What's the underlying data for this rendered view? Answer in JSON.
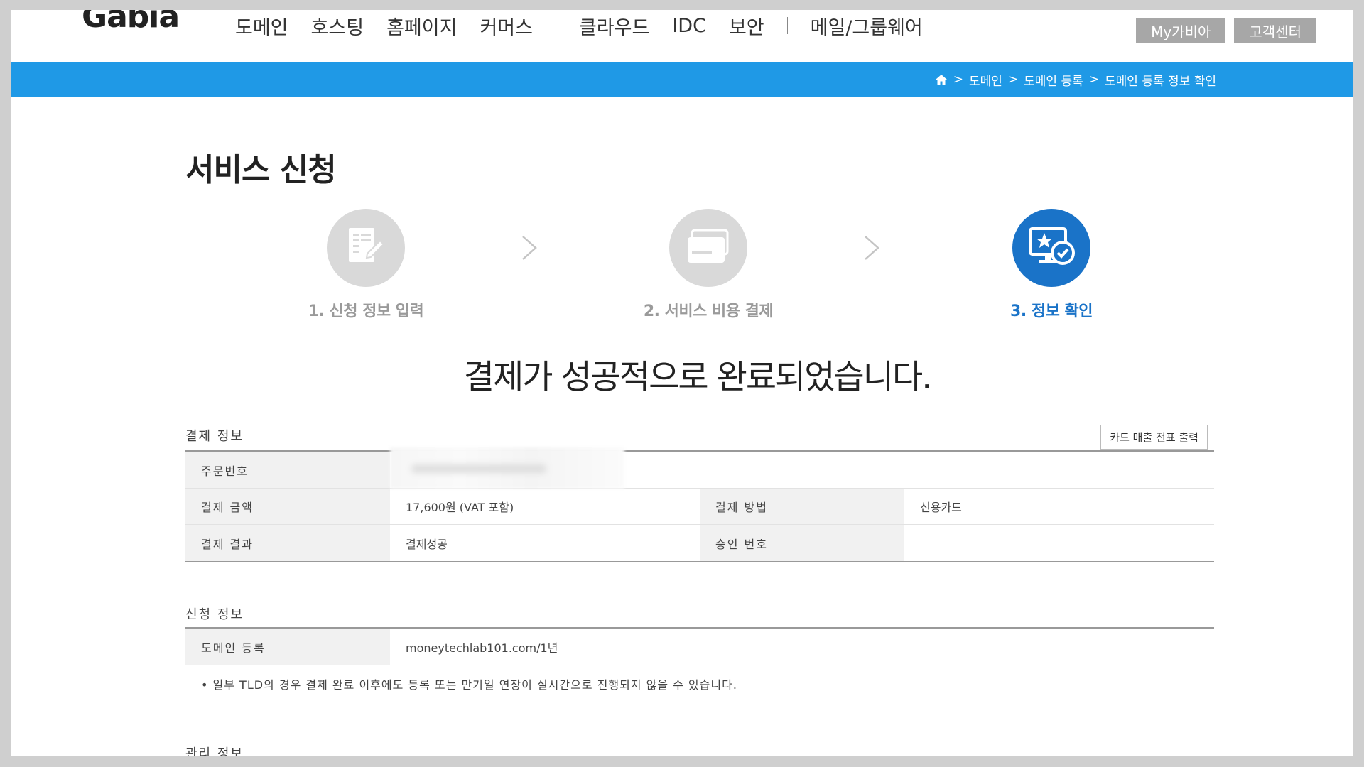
{
  "header": {
    "logo": "Gabia",
    "nav": [
      "도메인",
      "호스팅",
      "홈페이지",
      "커머스",
      "클라우드",
      "IDC",
      "보안",
      "메일/그룹웨어"
    ],
    "util_top": "",
    "my_gabia": "My가비아",
    "customer_center": "고객센터"
  },
  "breadcrumb": {
    "items": [
      "도메인",
      "도메인 등록",
      "도메인 등록 정보 확인"
    ],
    "separator": ">"
  },
  "page": {
    "title": "서비스 신청",
    "steps": [
      {
        "label": "1. 신청 정보 입력",
        "icon": "form-edit-icon",
        "active": false
      },
      {
        "label": "2. 서비스 비용 결제",
        "icon": "credit-card-icon",
        "active": false
      },
      {
        "label": "3. 정보 확인",
        "icon": "monitor-check-icon",
        "active": true
      }
    ],
    "success_message": "결제가 성공적으로 완료되었습니다."
  },
  "payment_info": {
    "section_title": "결제 정보",
    "print_button": "카드 매출 전표 출력",
    "order_number_label": "주문번호",
    "amount_label": "결제 금액",
    "amount_value": "17,600원 (VAT 포함)",
    "method_label": "결제 방법",
    "method_value": "신용카드",
    "result_label": "결제 결과",
    "result_value": "결제성공",
    "approval_label": "승인 번호",
    "approval_value": ""
  },
  "application_info": {
    "section_title": "신청 정보",
    "domain_label": "도메인 등록",
    "domain_value": "moneytechlab101.com/1년",
    "note": "• 일부 TLD의 경우 결제 완료 이후에도 등록 또는 만기일 연장이 실시간으로 진행되지 않을 수 있습니다."
  },
  "management_info": {
    "section_title": "관리 정보"
  },
  "colors": {
    "brand_blue": "#1f99e6",
    "active_step": "#1a73c8",
    "inactive_step": "#d9d9d9"
  }
}
